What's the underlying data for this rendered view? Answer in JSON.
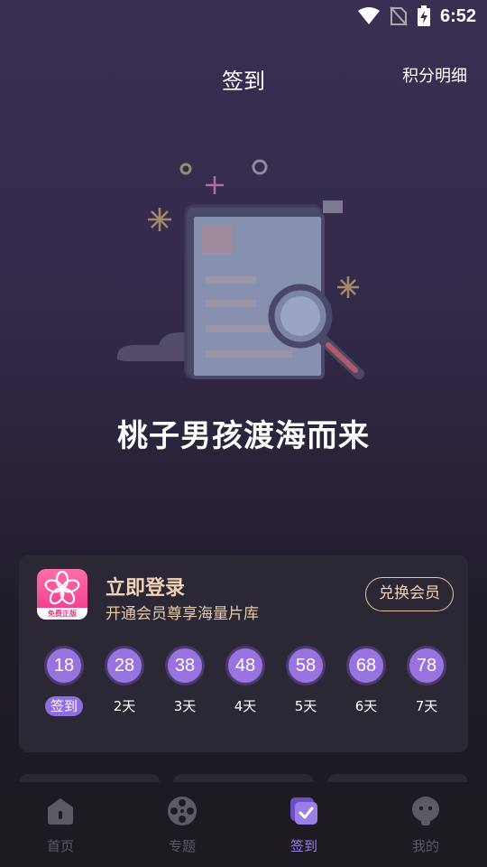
{
  "status_bar": {
    "time": "6:52"
  },
  "header": {
    "title": "签到",
    "points_link": "积分明细"
  },
  "hero": {
    "slogan": "桃子男孩渡海而来"
  },
  "card": {
    "logo_banner": "免费正版",
    "title": "立即登录",
    "subtitle": "开通会员尊享海量片库",
    "exchange_button": "兑换会员",
    "days": [
      {
        "points": "18",
        "label": "签到"
      },
      {
        "points": "28",
        "label": "2天"
      },
      {
        "points": "38",
        "label": "3天"
      },
      {
        "points": "48",
        "label": "4天"
      },
      {
        "points": "58",
        "label": "5天"
      },
      {
        "points": "68",
        "label": "6天"
      },
      {
        "points": "78",
        "label": "7天"
      }
    ]
  },
  "bottom_nav": {
    "items": [
      {
        "label": "首页",
        "icon": "home-icon"
      },
      {
        "label": "专题",
        "icon": "film-reel-icon"
      },
      {
        "label": "签到",
        "icon": "checkin-icon",
        "active": true
      },
      {
        "label": "我的",
        "icon": "profile-icon"
      }
    ]
  },
  "colors": {
    "accent": "#9974e0",
    "gold_text": "#f3d3b5",
    "nav_inactive": "#5d5a66",
    "nav_active": "#9c7fe6"
  }
}
